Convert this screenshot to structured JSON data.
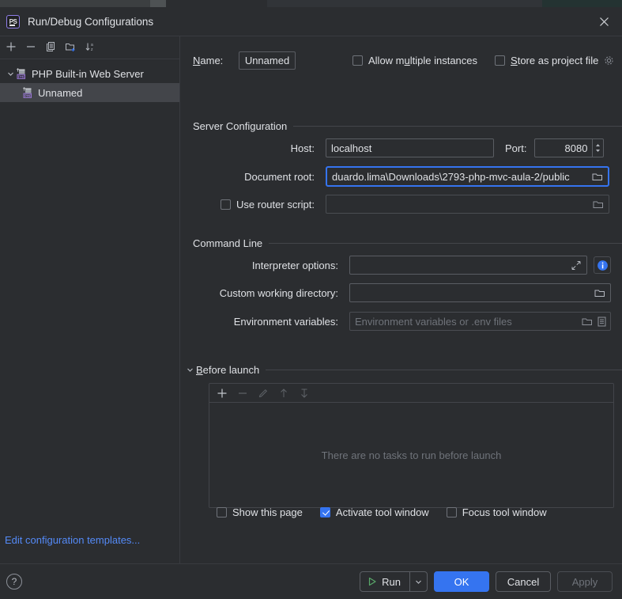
{
  "window": {
    "title": "Run/Debug Configurations",
    "app_icon": "phpstorm-ps-icon",
    "close_icon": "close-icon"
  },
  "left_panel": {
    "toolbar": [
      {
        "name": "add-configuration-button",
        "icon": "plus-icon",
        "enabled": true
      },
      {
        "name": "remove-configuration-button",
        "icon": "minus-icon",
        "enabled": true
      },
      {
        "name": "copy-configuration-button",
        "icon": "copy-icon",
        "enabled": true
      },
      {
        "name": "new-folder-button",
        "icon": "new-folder-icon",
        "enabled": true
      },
      {
        "name": "sort-configurations-button",
        "icon": "sort-alphabetical-icon",
        "enabled": true
      }
    ],
    "tree": [
      {
        "label": "PHP Built-in Web Server",
        "icon": "php-server-icon",
        "expanded": true,
        "selected": false,
        "level": 0
      },
      {
        "label": "Unnamed",
        "icon": "php-server-icon",
        "selected": true,
        "level": 1
      }
    ],
    "edit_templates_link": "Edit configuration templates..."
  },
  "main": {
    "name_label": "Name:",
    "name_label_mnemonic": "N",
    "name_value": "Unnamed",
    "allow_multiple_instances": {
      "label": "Allow multiple instances",
      "mnemonic": "u",
      "checked": false
    },
    "store_as_project_file": {
      "label": "Store as project file",
      "mnemonic": "S",
      "checked": false,
      "gear_icon": "gear-icon"
    },
    "server_configuration": {
      "title": "Server Configuration",
      "host_label": "Host:",
      "host_value": "localhost",
      "port_label": "Port:",
      "port_value": "8080",
      "document_root_label": "Document root:",
      "document_root_value": "duardo.lima\\Downloads\\2793-php-mvc-aula-2/public",
      "document_root_focused": true,
      "use_router_script": {
        "label": "Use router script:",
        "checked": false,
        "value": ""
      }
    },
    "command_line": {
      "title": "Command Line",
      "interpreter_options_label": "Interpreter options:",
      "interpreter_options_value": "",
      "custom_working_directory_label": "Custom working directory:",
      "custom_working_directory_value": "",
      "environment_variables_label": "Environment variables:",
      "environment_variables_placeholder": "Environment variables or .env files"
    },
    "before_launch": {
      "title": "Before launch",
      "mnemonic": "B",
      "expanded": true,
      "toolbar": [
        {
          "name": "add-task-button",
          "icon": "plus-icon",
          "enabled": true
        },
        {
          "name": "remove-task-button",
          "icon": "minus-icon",
          "enabled": false
        },
        {
          "name": "edit-task-button",
          "icon": "pencil-icon",
          "enabled": false
        },
        {
          "name": "move-task-up-button",
          "icon": "arrow-up-icon",
          "enabled": false
        },
        {
          "name": "move-task-down-button",
          "icon": "arrow-down-icon",
          "enabled": false
        }
      ],
      "empty_text": "There are no tasks to run before launch"
    },
    "bottom_options": [
      {
        "label": "Show this page",
        "checked": false,
        "name": "show-this-page-checkbox"
      },
      {
        "label": "Activate tool window",
        "checked": true,
        "name": "activate-tool-window-checkbox"
      },
      {
        "label": "Focus tool window",
        "checked": false,
        "name": "focus-tool-window-checkbox"
      }
    ]
  },
  "footer": {
    "help_icon": "help-icon",
    "run_label": "Run",
    "run_icon": "play-icon",
    "run_dropdown_icon": "chevron-down-icon",
    "ok_label": "OK",
    "cancel_label": "Cancel",
    "apply_label": "Apply",
    "apply_enabled": false
  },
  "colors": {
    "accent": "#3574f0",
    "link": "#548af7",
    "background": "#2b2d30",
    "selection": "#43454a",
    "run_green": "#59a869",
    "php_purple": "#9876d3"
  }
}
